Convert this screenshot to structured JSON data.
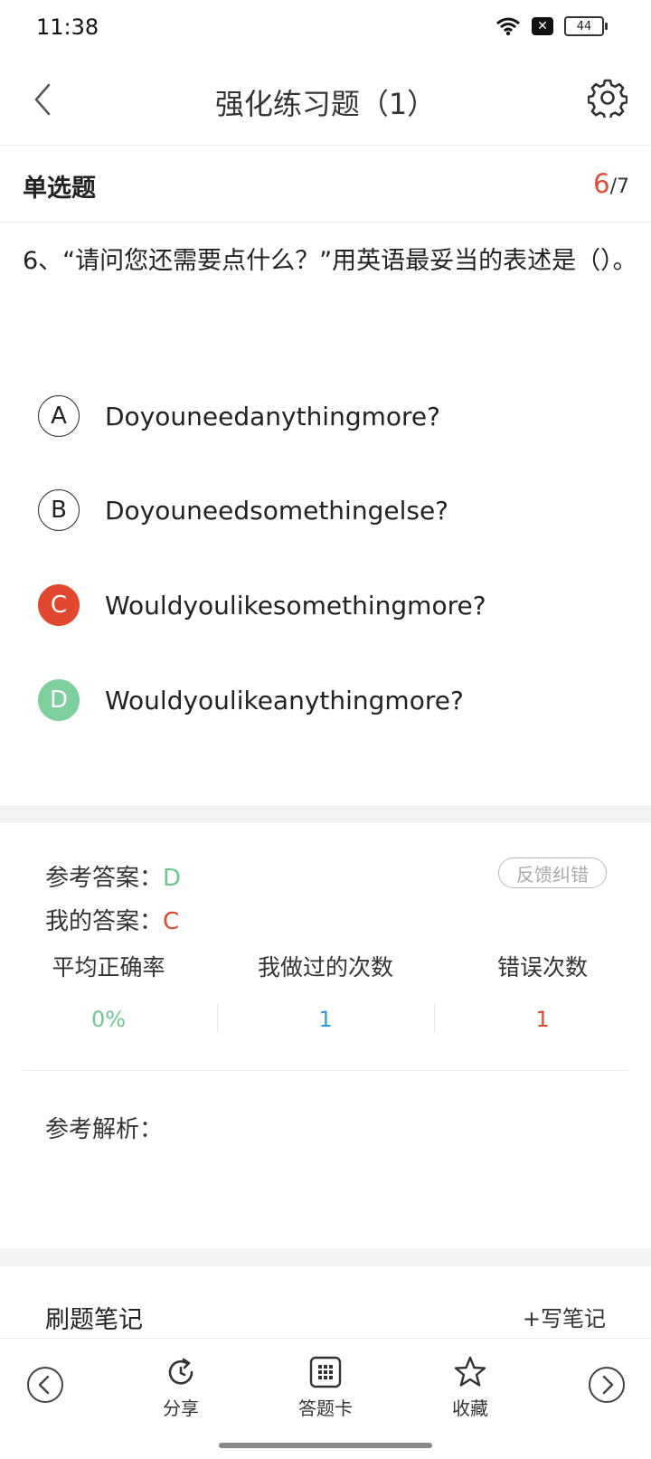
{
  "status_bar": {
    "time": "11:38",
    "battery": "44",
    "icons": [
      "wifi-icon",
      "notification-x-icon",
      "battery-icon"
    ]
  },
  "header": {
    "title": "强化练习题（1）",
    "icons": [
      "back-chevron-icon",
      "gear-icon"
    ]
  },
  "question_meta": {
    "type": "单选题",
    "current": "6",
    "total": "/7"
  },
  "question": {
    "text": "6、“请问您还需要点什么？”用英语最妥当的表述是（）。"
  },
  "options": [
    {
      "letter": "A",
      "text": "Doyouneedanythingmore?",
      "state": "default"
    },
    {
      "letter": "B",
      "text": "Doyouneedsomethingelse?",
      "state": "default"
    },
    {
      "letter": "C",
      "text": "Wouldyoulikesomethingmore?",
      "state": "wrong"
    },
    {
      "letter": "D",
      "text": "Wouldyoulikeanythingmore?",
      "state": "correct"
    }
  ],
  "answer": {
    "reference_label": "参考答案：",
    "reference_value": "D",
    "mine_label": "我的答案：",
    "mine_value": "C",
    "feedback_button": "反馈纠错"
  },
  "stats": {
    "headers": [
      "平均正确率",
      "我做过的次数",
      "错误次数"
    ],
    "values": [
      "0%",
      "1",
      "1"
    ],
    "colors": [
      "#6cc690",
      "#2f9bd6",
      "#e2482f"
    ]
  },
  "analysis": {
    "label": "参考解析："
  },
  "notes": {
    "title": "刷题笔记",
    "write_button": "+写笔记"
  },
  "bottom_nav": {
    "share": "分享",
    "answer_card": "答题卡",
    "favorite": "收藏",
    "icons": [
      "prev-arrow-icon",
      "share-icon",
      "grid-icon",
      "star-icon",
      "next-arrow-icon"
    ]
  },
  "colors": {
    "accent_red": "#e2482f",
    "accent_green": "#7dcf9d",
    "accent_blue": "#2f9bd6"
  }
}
